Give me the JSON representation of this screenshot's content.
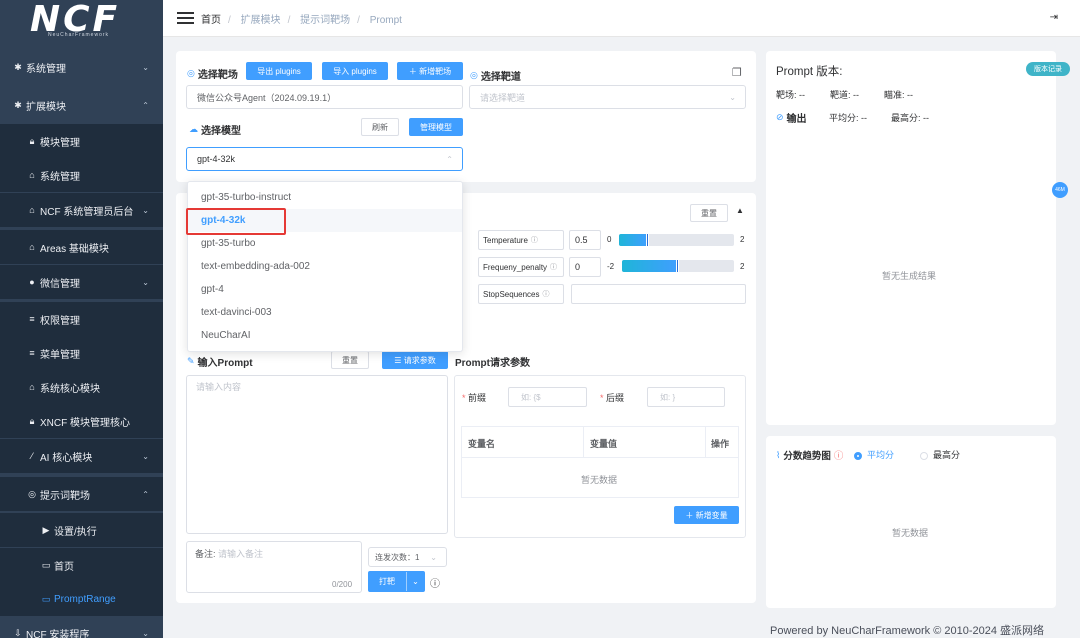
{
  "logo": {
    "text": "NCF",
    "subtitle": "NeuCharFramework"
  },
  "sidebar": {
    "items": [
      {
        "label": "系统管理",
        "icon": "gear-icon",
        "arrow": "⌄"
      },
      {
        "label": "扩展模块",
        "icon": "gear-icon",
        "arrow": "⌃"
      },
      {
        "label": "模块管理",
        "icon": "lock-icon"
      },
      {
        "label": "系统管理",
        "icon": "bank-icon"
      },
      {
        "label": "NCF 系统管理员后台",
        "icon": "bank-icon",
        "arrow": "⌄"
      },
      {
        "label": "Areas 基础模块",
        "icon": "bank-icon"
      },
      {
        "label": "微信管理",
        "icon": "wechat-icon",
        "arrow": "⌄"
      },
      {
        "label": "权限管理",
        "icon": "list-icon"
      },
      {
        "label": "菜单管理",
        "icon": "list-icon"
      },
      {
        "label": "系统核心模块",
        "icon": "bank-icon"
      },
      {
        "label": "XNCF 模块管理核心",
        "icon": "lock-icon"
      },
      {
        "label": "AI 核心模块",
        "icon": "magic-icon",
        "arrow": "⌄"
      },
      {
        "label": "提示词靶场",
        "icon": "target-icon",
        "arrow": "⌃"
      },
      {
        "label": "设置/执行",
        "icon": "play-icon"
      },
      {
        "label": "首页",
        "icon": "monitor-icon"
      },
      {
        "label": "PromptRange",
        "icon": "monitor-icon"
      },
      {
        "label": "NCF 安装程序",
        "icon": "download-icon",
        "arrow": "⌄"
      }
    ]
  },
  "breadcrumb": [
    "首页",
    "扩展模块",
    "提示词靶场",
    "Prompt"
  ],
  "left_panel": {
    "range_label": "选择靶场",
    "export_btn": "导出 plugins",
    "import_btn": "导入 plugins",
    "new_range_btn": "＋ 新增靶场",
    "range_value": "微信公众号Agent（2024.09.19.1）",
    "lane_label": "选择靶道",
    "lane_placeholder": "请选择靶道",
    "model_label": "选择模型",
    "refresh_btn": "刷新",
    "manage_btn": "管理模型",
    "model_value": "gpt-4-32k",
    "model_options": [
      "gpt-35-turbo-instruct",
      "gpt-4-32k",
      "gpt-35-turbo",
      "text-embedding-ada-002",
      "gpt-4",
      "text-davinci-003",
      "NeuCharAI"
    ],
    "selected_option": "gpt-4-32k",
    "reset_btn": "重置",
    "params": [
      {
        "name": "Temperature",
        "value": "0.5",
        "min": "0",
        "max": "2",
        "level": 0.25
      },
      {
        "name": "Frequeny_penalty",
        "value": "0",
        "min": "-2",
        "max": "2",
        "level": 0.5
      },
      {
        "name": "StopSequences",
        "value": ""
      }
    ],
    "prompt_label": "输入Prompt",
    "prompt_reset": "重置",
    "request_params_btn": "☰ 请求参数",
    "prompt_placeholder": "请输入内容",
    "request_params_title": "Prompt请求参数",
    "prefix_label": "前缀",
    "prefix_placeholder": "如: {$",
    "suffix_label": "后缀",
    "suffix_placeholder": "如: }",
    "table_headers": [
      "变量名",
      "变量值",
      "操作"
    ],
    "table_empty": "暂无数据",
    "add_var_btn": "＋ 新增变量",
    "note_label": "备注:",
    "note_placeholder": "请输入备注",
    "note_count": "0/200",
    "repeat_label": "连发次数：1",
    "shoot_btn": "打靶"
  },
  "right_panel": {
    "title": "Prompt 版本:",
    "version_tag": "版本记录",
    "range": "靶场: --",
    "lane": "靶道: --",
    "aim": "瞄准: --",
    "output_label": "输出",
    "avg": "平均分: --",
    "max": "最高分: --",
    "no_result": "暂无生成结果",
    "trend_label": "分数趋势图",
    "radio_avg": "平均分",
    "radio_max": "最高分",
    "trend_empty": "暂无数据",
    "circle": "46M"
  },
  "footer": "Powered by NeuCharFramework © 2010-2024 盛派网络"
}
